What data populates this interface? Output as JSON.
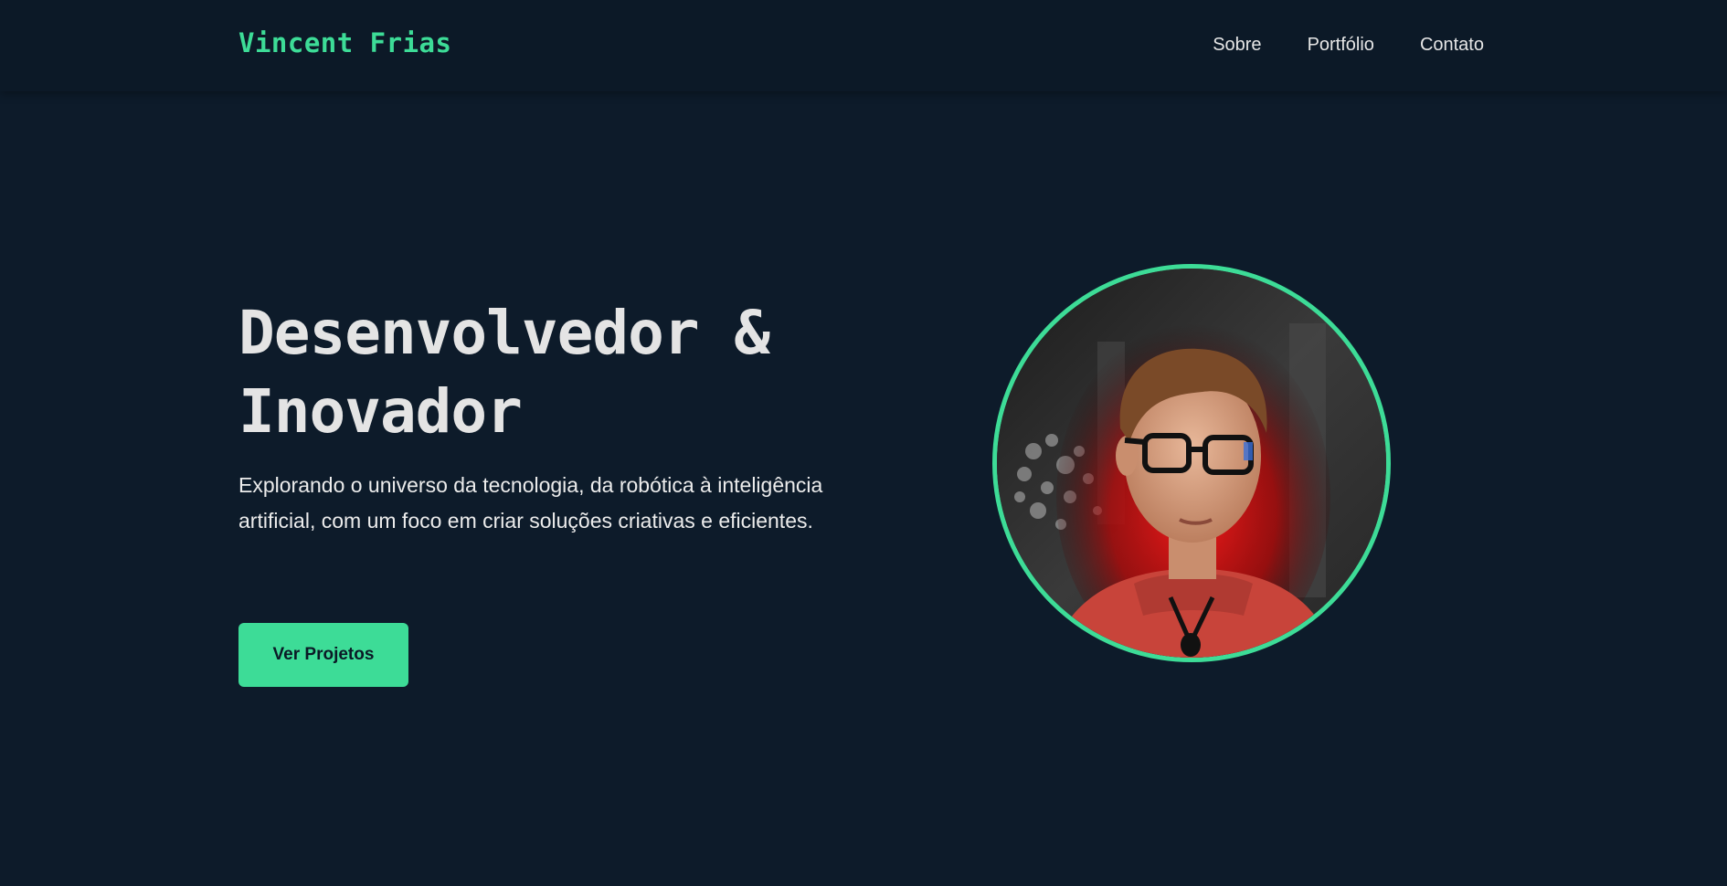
{
  "header": {
    "logo": "Vincent Frias",
    "nav": [
      {
        "label": "Sobre"
      },
      {
        "label": "Portfólio"
      },
      {
        "label": "Contato"
      }
    ]
  },
  "hero": {
    "title_line1": "Desenvolvedor &",
    "title_line2": "Inovador",
    "subtitle": "Explorando o universo da tecnologia, da robótica à inteligência artificial, com um foco em criar soluções criativas e eficientes.",
    "cta_label": "Ver Projetos"
  },
  "colors": {
    "background": "#0d1b2a",
    "accent": "#3ddc97",
    "text": "#e6e6e6"
  }
}
